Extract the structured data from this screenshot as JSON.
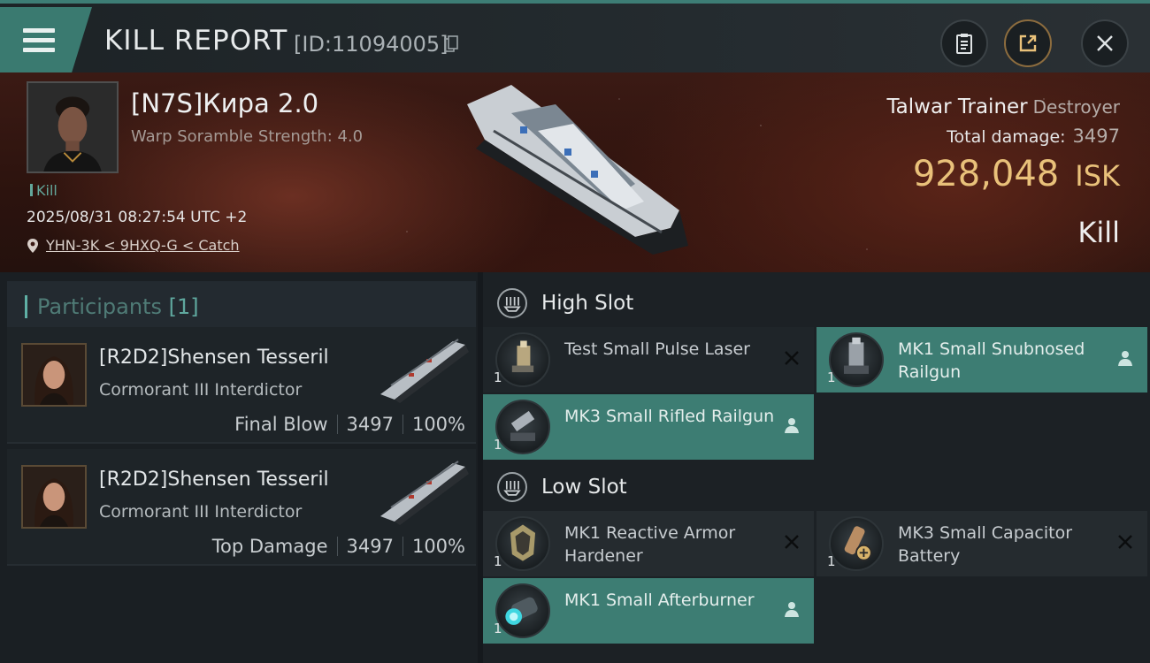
{
  "header": {
    "title": "KILL REPORT",
    "report_id": "[ID:11094005]"
  },
  "victim": {
    "name": "[N7S]Кира 2.0",
    "scramble": "Warp Soramble Strength: 4.0",
    "tag": "Kill",
    "timestamp": "2025/08/31 08:27:54 UTC +2",
    "location": "YHN-3K < 9HXQ-G < Catch",
    "ship": "Talwar Trainer",
    "ship_class": "Destroyer",
    "damage_label": "Total damage:",
    "damage_value": "3497",
    "isk_value": "928,048",
    "isk_unit": "ISK",
    "result": "Kill"
  },
  "participants": {
    "label": "Participants",
    "count": "[1]",
    "rows": [
      {
        "name": "[R2D2]Shensen Tesseril",
        "ship": "Cormorant III Interdictor",
        "role": "Final Blow",
        "damage": "3497",
        "percent": "100%"
      },
      {
        "name": "[R2D2]Shensen Tesseril",
        "ship": "Cormorant III Interdictor",
        "role": "Top Damage",
        "damage": "3497",
        "percent": "100%"
      }
    ]
  },
  "fitting": {
    "high_slot": {
      "label": "High Slot",
      "modules": [
        {
          "qty": "1",
          "name": "Test Small Pulse Laser",
          "status": "destroyed",
          "icon": "laser-turret-icon"
        },
        {
          "qty": "1",
          "name": "MK1 Small Snubnosed Railgun",
          "status": "dropped",
          "icon": "railgun-turret-icon"
        },
        {
          "qty": "1",
          "name": "MK3 Small Rifled Railgun",
          "status": "dropped",
          "icon": "railgun-turret-icon"
        }
      ]
    },
    "low_slot": {
      "label": "Low Slot",
      "modules": [
        {
          "qty": "1",
          "name": "MK1 Reactive Armor Hardener",
          "status": "destroyed",
          "icon": "armor-hardener-icon"
        },
        {
          "qty": "1",
          "name": "MK3 Small Capacitor Battery",
          "status": "destroyed",
          "icon": "capacitor-battery-icon"
        },
        {
          "qty": "1",
          "name": "MK1 Small Afterburner",
          "status": "dropped",
          "icon": "afterburner-icon"
        }
      ]
    }
  },
  "colors": {
    "accent": "#3d7d73",
    "isk": "#e9c17a",
    "teal_text": "#5fb0a5"
  }
}
